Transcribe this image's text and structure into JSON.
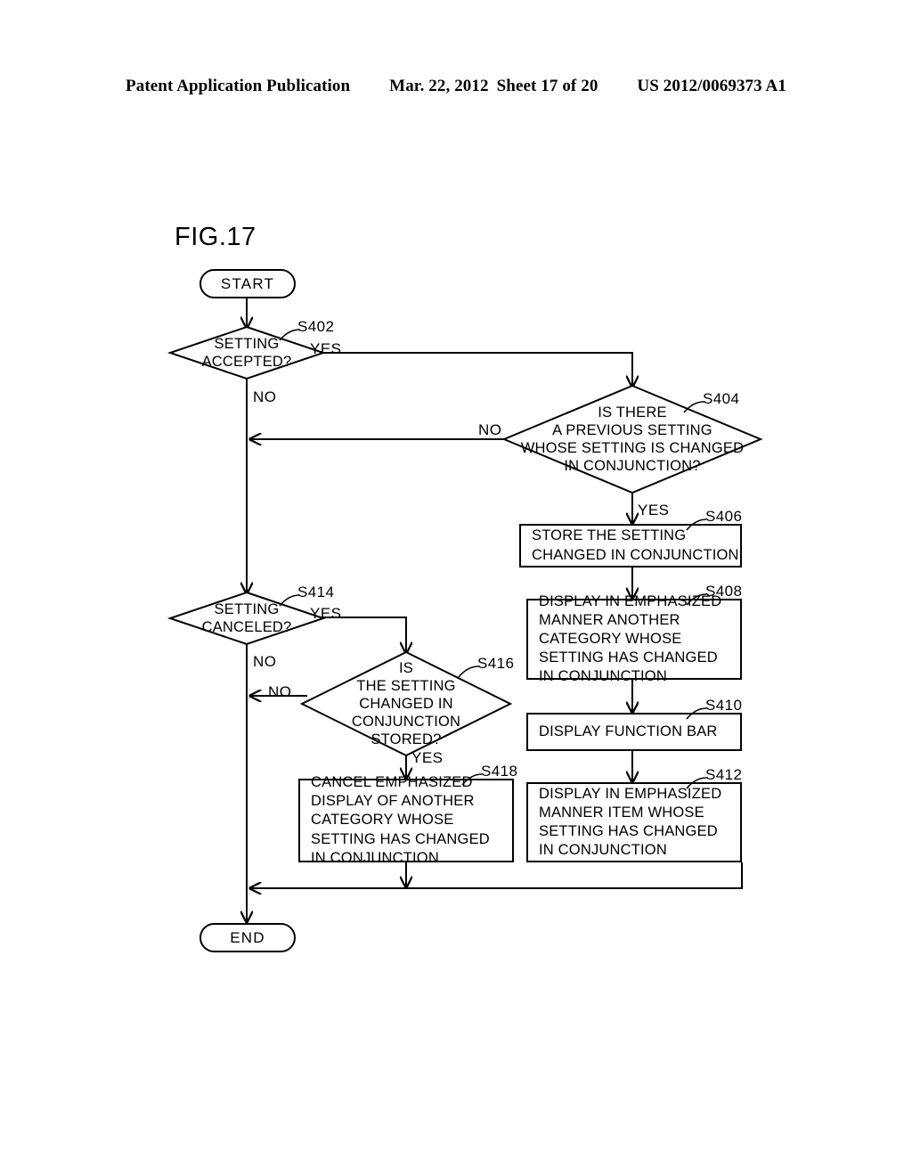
{
  "header": {
    "publication": "Patent Application Publication",
    "date": "Mar. 22, 2012",
    "sheet": "Sheet 17 of 20",
    "patent_number": "US 2012/0069373 A1"
  },
  "figure": {
    "label": "FIG.17"
  },
  "nodes": {
    "start": {
      "id": "START",
      "label": "START"
    },
    "end": {
      "id": "END",
      "label": "END"
    },
    "s402": {
      "ref": "S402",
      "lines": [
        "SETTING",
        "ACCEPTED?"
      ],
      "yes": "YES",
      "no": "NO"
    },
    "s404": {
      "ref": "S404",
      "lines": [
        "IS THERE",
        "A PREVIOUS SETTING",
        "WHOSE SETTING IS CHANGED",
        "IN CONJUNCTION?"
      ],
      "yes": "YES",
      "no": "NO"
    },
    "s406": {
      "ref": "S406",
      "lines": [
        "STORE THE SETTING",
        "CHANGED IN CONJUNCTION"
      ]
    },
    "s408": {
      "ref": "S408",
      "lines": [
        "DISPLAY IN EMPHASIZED",
        "MANNER ANOTHER",
        "CATEGORY WHOSE",
        "SETTING HAS CHANGED",
        "IN CONJUNCTION"
      ]
    },
    "s410": {
      "ref": "S410",
      "lines": [
        "DISPLAY FUNCTION BAR"
      ]
    },
    "s412": {
      "ref": "S412",
      "lines": [
        "DISPLAY IN EMPHASIZED",
        "MANNER ITEM WHOSE",
        "SETTING HAS CHANGED",
        "IN CONJUNCTION"
      ]
    },
    "s414": {
      "ref": "S414",
      "lines": [
        "SETTING",
        "CANCELED?"
      ],
      "yes": "YES",
      "no": "NO"
    },
    "s416": {
      "ref": "S416",
      "lines": [
        "IS",
        "THE SETTING",
        "CHANGED IN",
        "CONJUNCTION",
        "STORED?"
      ],
      "yes": "YES",
      "no": "NO"
    },
    "s418": {
      "ref": "S418",
      "lines": [
        "CANCEL EMPHASIZED",
        "DISPLAY OF ANOTHER",
        "CATEGORY WHOSE",
        "SETTING HAS CHANGED",
        "IN CONJUNCTION"
      ]
    }
  },
  "style": {
    "line_color": "#000000",
    "background": "#ffffff"
  }
}
